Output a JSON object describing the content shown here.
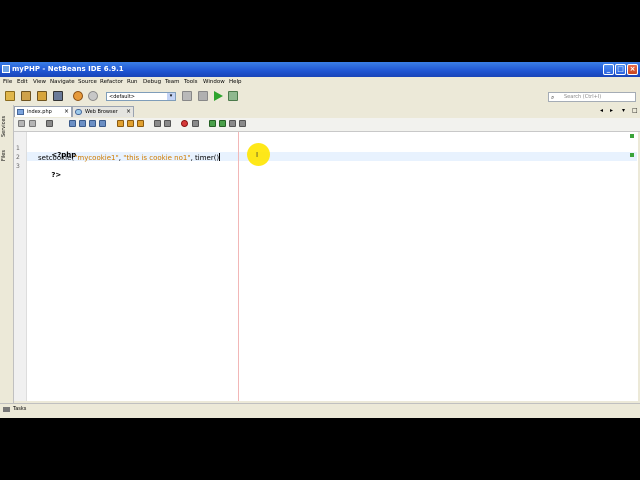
{
  "window": {
    "title": "myPHP - NetBeans IDE 6.9.1",
    "minimize": "_",
    "maximize": "□",
    "close": "×"
  },
  "menu": [
    "File",
    "Edit",
    "View",
    "Navigate",
    "Source",
    "Refactor",
    "Run",
    "Debug",
    "Team",
    "Tools",
    "Window",
    "Help"
  ],
  "toolbar": {
    "config_value": "<default>",
    "search_placeholder": "Search (Ctrl+I)"
  },
  "side_tabs": [
    "Services",
    "Files"
  ],
  "tabs": [
    {
      "label": "index.php",
      "active": true
    },
    {
      "label": "Web Browser",
      "active": false
    }
  ],
  "editor": {
    "line_numbers": [
      "1",
      "2",
      "3"
    ],
    "lines": {
      "l1": "<?php",
      "l2_fn": "setcookie(",
      "l2_s1": "\"mycookie1\"",
      "l2_sep1": ", ",
      "l2_s2": "\"this is cookie no1\"",
      "l2_sep2": ", timer()",
      "l3": "?>"
    }
  },
  "bottom": {
    "tasks_label": "Tasks"
  }
}
